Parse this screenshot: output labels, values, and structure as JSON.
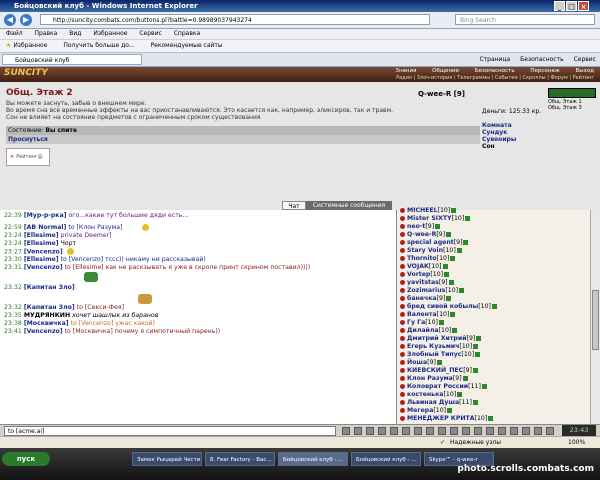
{
  "window": {
    "title": "Бойцовский клуб - Windows Internet Explorer"
  },
  "browser": {
    "url": "http://suncity.combats.com/buttons.pl?battle=0.98989037943274",
    "search_placeholder": "Bing Search",
    "menu": [
      "Файл",
      "Правка",
      "Вид",
      "Избранное",
      "Сервис",
      "Справка"
    ],
    "favorites_label": "Избранное",
    "favorites_links": [
      "Получить больше до...",
      "Рекомендуемые сайты"
    ],
    "tab_title": "Бойцовский клуб",
    "tab_tools": [
      "Страница",
      "Безопасность",
      "Сервис"
    ]
  },
  "game": {
    "logo": "SUNCITY",
    "nav": [
      "Знания",
      "Общение",
      "Безопасность",
      "Персонаж",
      "Выход"
    ],
    "subnav": "Радио | Злоч-история | Телеграммы | События | Скроллы | Форум | Рейтинг"
  },
  "room": {
    "title": "Общ. Этаж 2",
    "lines": [
      "Вы можете заснуть, забыв о внешнем мире.",
      "Во время сна все временные эффекты на вас приостанавливаются. Это касается как, например, эликсиров, так и травм.",
      "Сон не влияет на состояние предметов с ограниченным сроком существования"
    ],
    "state_label": "Состояние:",
    "state_value": "Вы спите",
    "wake_link": "Проснуться",
    "rating_label": "Рейтинг@",
    "player": "Q-wee-R [9]",
    "money": "Деньги: 125.33 кр.",
    "links": [
      "Комната",
      "Сундук",
      "Сувениры",
      "Сон"
    ],
    "floors": [
      "Общ. Этаж 1",
      "Общ. Этаж 3"
    ],
    "rating_icon": "broken-image-icon"
  },
  "chat": {
    "tab_chat": "Чат",
    "tab_system": "Системные сообщения",
    "messages": [
      {
        "time": "22:39",
        "nick": "[Мур-р-рка]",
        "text": "ого...какие тут большие дяди есть..."
      },
      {
        "time": "22:59",
        "nick": "[AB Normal]",
        "text": "to [Клон Разума]"
      },
      {
        "time": "23:24",
        "nick": "[Ellesime]",
        "text": "private Deemer]"
      },
      {
        "time": "23:24",
        "nick": "[Ellesime]",
        "text": "Чорт"
      },
      {
        "time": "23:27",
        "nick": "[Vencenzo]",
        "text": ""
      },
      {
        "time": "23:30",
        "nick": "[Ellesime]",
        "text": "to [Vencenzo] тссс)) никаму ни рассказывай)"
      },
      {
        "time": "23:31",
        "nick": "[Vencenzo]",
        "text": "to [Ellesime] как не раскзывать я уже в скроле принт скрином поставил))))"
      },
      {
        "time": "23:32",
        "nick": "[Капитан Зло]",
        "text": ""
      },
      {
        "time": "23:32",
        "nick": "[Капитан Зло]",
        "text": "to [Секси-Фея]"
      },
      {
        "time": "23:35",
        "nick": "МУДРЯНКИН",
        "text": "хочет шашлык из баранов"
      },
      {
        "time": "23:38",
        "nick": "[Москвичка]",
        "text": "to [Vencenzo] ужас какой)"
      },
      {
        "time": "23:41",
        "nick": "[Vencenzo]",
        "text": "to [Москвичка] почему я симпотичный парень))"
      }
    ],
    "input_value": "to [acme.ai]",
    "clock": "23:43"
  },
  "users": [
    {
      "name": "MICHEEL",
      "level": "[10]"
    },
    {
      "name": "Mister SIXTY",
      "level": "[10]"
    },
    {
      "name": "neo-t",
      "level": "[9]"
    },
    {
      "name": "Q-wee-R",
      "level": "[9]"
    },
    {
      "name": "special agent",
      "level": "[9]"
    },
    {
      "name": "Stary Voin",
      "level": "[10]"
    },
    {
      "name": "Thornito",
      "level": "[10]"
    },
    {
      "name": "VOJAK",
      "level": "[10]"
    },
    {
      "name": "Vortep",
      "level": "[10]"
    },
    {
      "name": "yavitstas",
      "level": "[9]"
    },
    {
      "name": "Zozimarius",
      "level": "[10]"
    },
    {
      "name": "банечка",
      "level": "[9]"
    },
    {
      "name": "бред сивой кобылы",
      "level": "[10]"
    },
    {
      "name": "Валента",
      "level": "[10]"
    },
    {
      "name": "Гу Га",
      "level": "[10]"
    },
    {
      "name": "Дилайла",
      "level": "[10]"
    },
    {
      "name": "Дмитрий Хитрий",
      "level": "[9]"
    },
    {
      "name": "Егерь Кузьмич",
      "level": "[10]"
    },
    {
      "name": "Злобный Типус",
      "level": "[10]"
    },
    {
      "name": "Йоша",
      "level": "[9]"
    },
    {
      "name": "КИЕВСКИЙ_ПЕС",
      "level": "[9]"
    },
    {
      "name": "Клон Разума",
      "level": "[9]"
    },
    {
      "name": "Коловрат России",
      "level": "[11]"
    },
    {
      "name": "костенька",
      "level": "[10]"
    },
    {
      "name": "Львиная Душа",
      "level": "[11]"
    },
    {
      "name": "Мегера",
      "level": "[10]"
    },
    {
      "name": "МЕНЕДЖЕР КРИТА",
      "level": "[10]"
    }
  ],
  "statusbar": {
    "text": "Надежные узлы",
    "zoom": "100%"
  },
  "taskbar": {
    "start": "пуск",
    "tasks": [
      "Замок Рыцарей Чести ...",
      "8. Fear Factory - Bac...",
      "Бойцовский клуб - ...",
      "Бойцовский клуб - ...",
      "Skype™ - q-wee-r"
    ],
    "watermark": "photo.scrolls.combats.com"
  }
}
